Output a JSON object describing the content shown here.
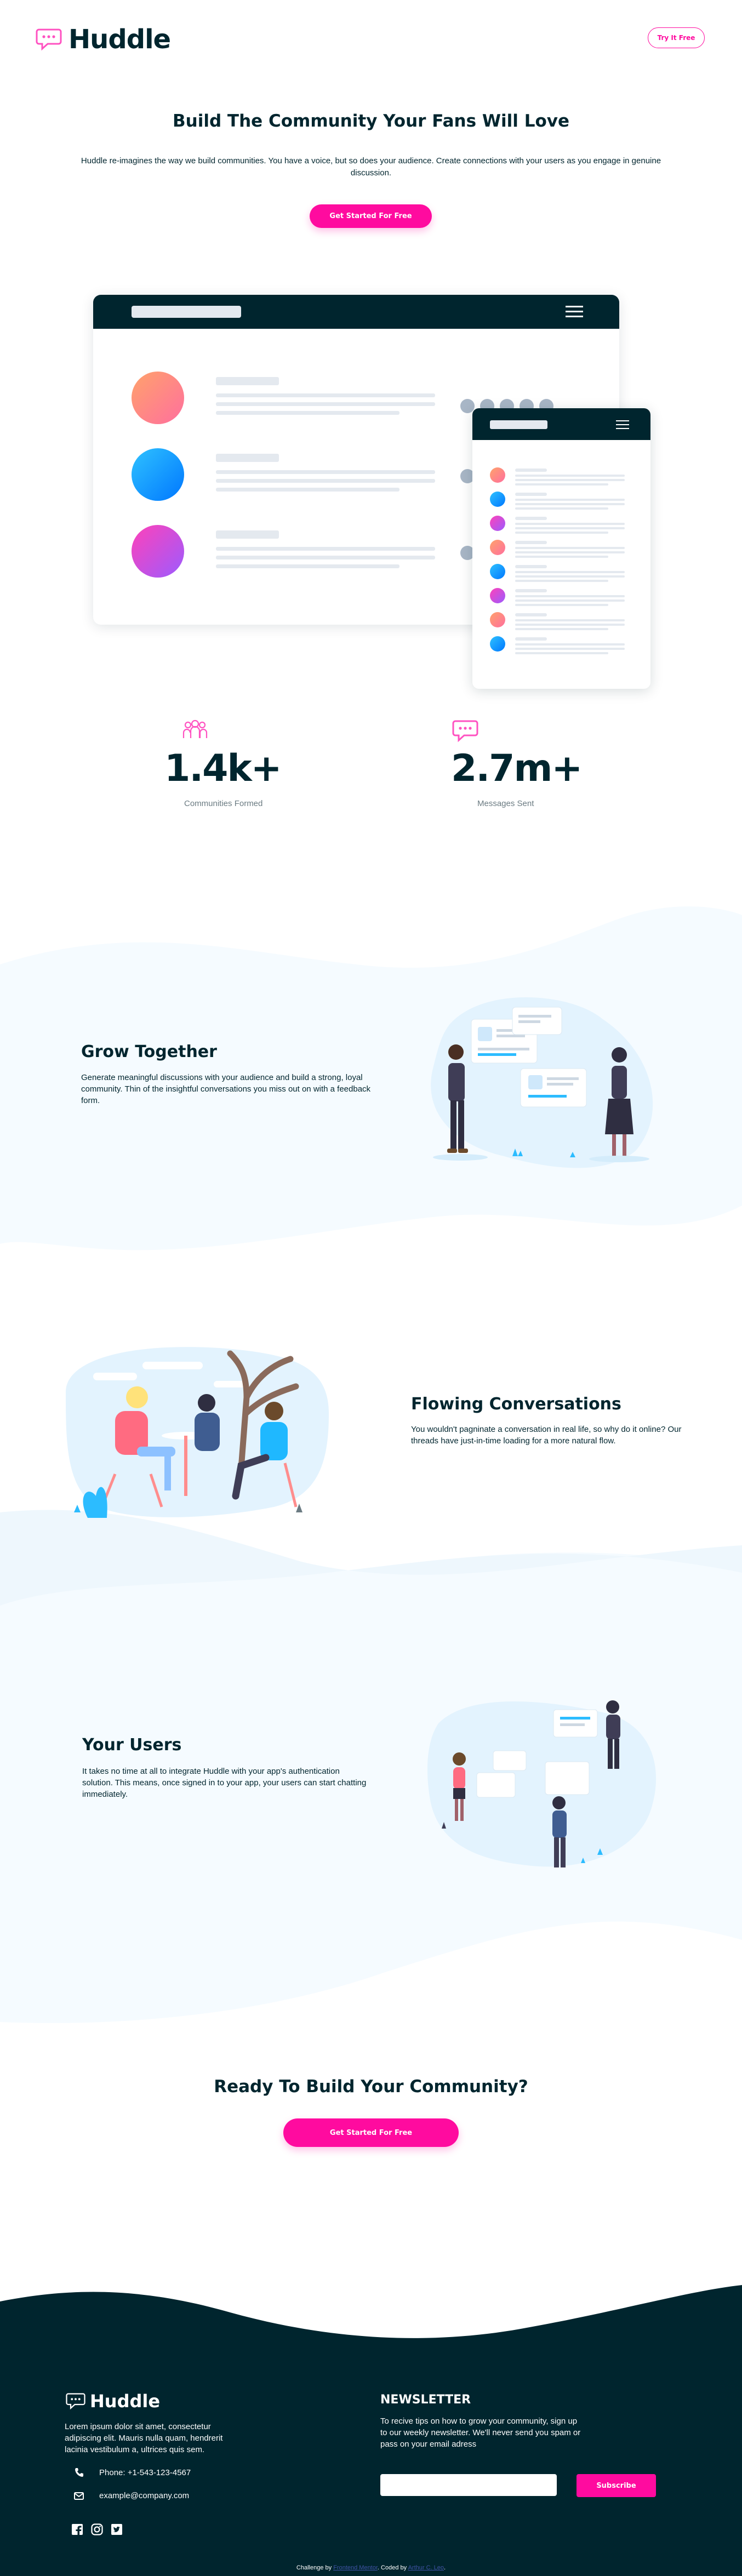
{
  "header": {
    "brand": "Huddle",
    "try_button": "Try It Free"
  },
  "hero": {
    "title": "Build The Community Your Fans Will Love",
    "description": "Huddle re-imagines the way we build communities. You have a voice, but so does your audience. Create connections with your users as you engage in genuine discussion.",
    "cta": "Get Started For Free"
  },
  "stats": [
    {
      "value": "1.4k+",
      "label": "Communities Formed",
      "icon": "communities-icon"
    },
    {
      "value": "2.7m+",
      "label": "Messages Sent",
      "icon": "messages-icon"
    }
  ],
  "features": [
    {
      "title": "Grow Together",
      "text": "Generate meaningful discussions with your audience and build a strong, loyal community. Thin of the insightful conversations you miss out on with a feedback form."
    },
    {
      "title": "Flowing Conversations",
      "text": "You wouldn't pagninate a conversation in real life, so why do it online? Our threads have just-in-time loading for a more natural flow."
    },
    {
      "title": "Your Users",
      "text": "It takes no time at all to integrate Huddle with your app's authentication solution. This means, once signed in to your app, your users can start chatting immediately."
    }
  ],
  "cta_section": {
    "title": "Ready To Build Your Community?",
    "button": "Get Started For Free"
  },
  "footer": {
    "brand": "Huddle",
    "about": "Lorem ipsum dolor sit amet, consectetur adipiscing elit. Mauris nulla quam, hendrerit lacinia vestibulum a, ultrices quis sem.",
    "phone": "Phone: +1-543-123-4567",
    "email": "example@company.com",
    "newsletter_title": "NEWSLETTER",
    "newsletter_text": "To recive tips on how to grow your community, sign up to our weekly newsletter. We'll never send you spam or pass on your email adress",
    "email_placeholder": "",
    "subscribe": "Subscribe",
    "attribution_prefix": "Challenge by",
    "attribution_link1": "Frontend Mentor",
    "attribution_mid": ". Coded by",
    "attribution_link2": "Arthur C. Leo",
    "attribution_suffix": "."
  },
  "colors": {
    "pink": "#ff0b9f",
    "navy": "#00252e",
    "light_bg": "#f5fbff",
    "mock_bar": "#e4e9ef"
  }
}
